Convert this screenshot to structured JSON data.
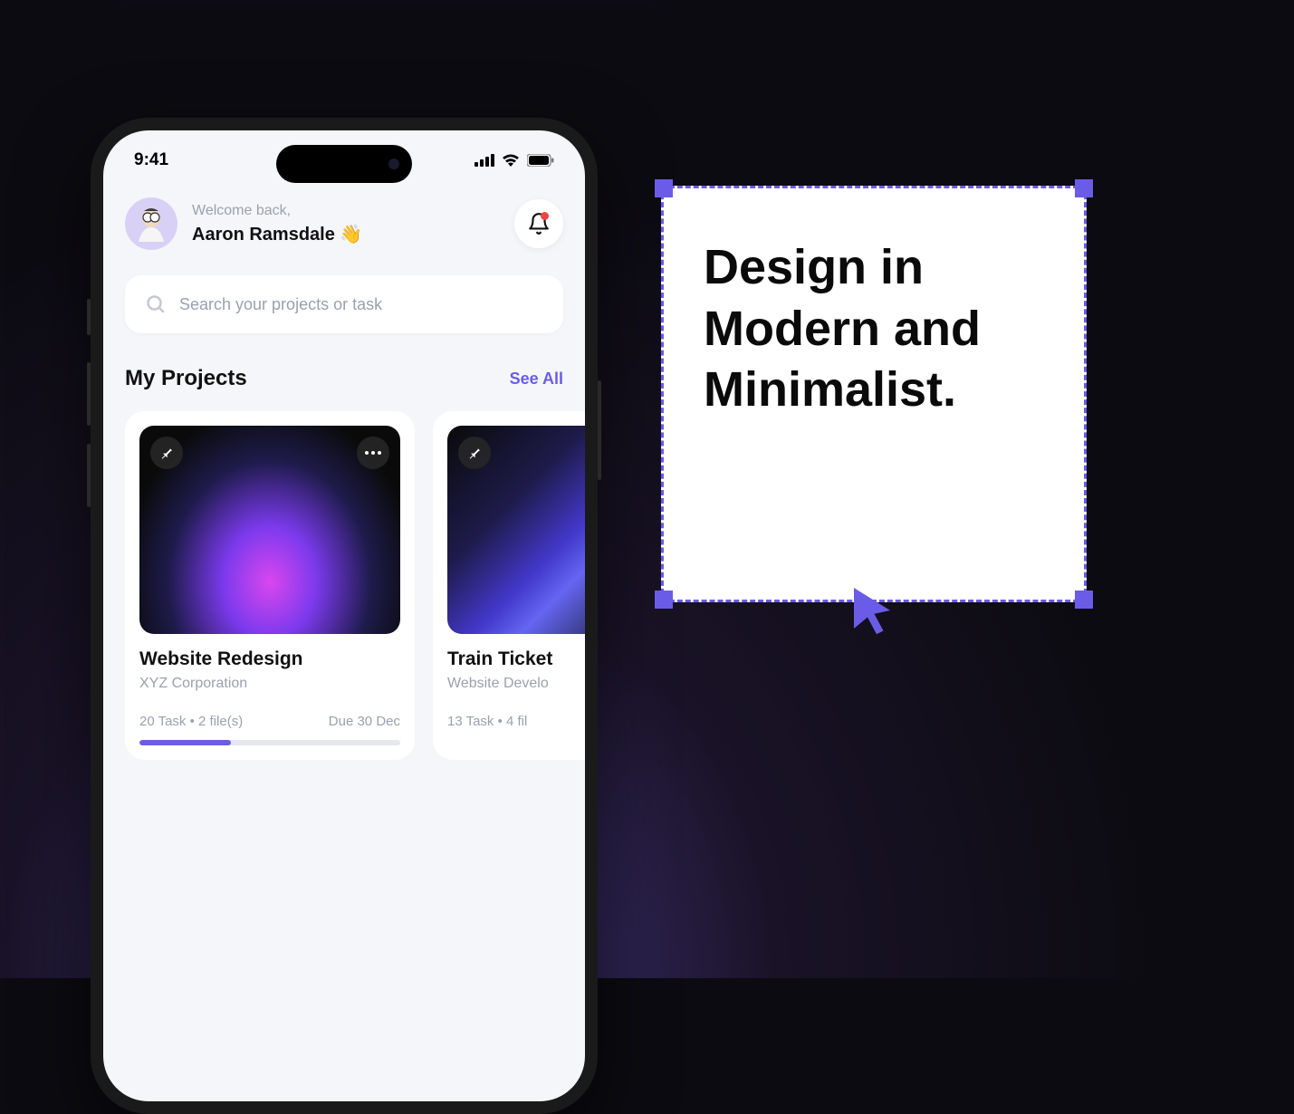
{
  "statusBar": {
    "time": "9:41"
  },
  "header": {
    "welcome": "Welcome back,",
    "name": "Aaron Ramsdale 👋"
  },
  "search": {
    "placeholder": "Search your projects or task"
  },
  "projects": {
    "title": "My Projects",
    "seeAll": "See All",
    "cards": [
      {
        "title": "Website Redesign",
        "subtitle": "XYZ Corporation",
        "metaLeft": "20 Task  •  2 file(s)",
        "metaRight": "Due 30 Dec"
      },
      {
        "title": "Train Ticket",
        "subtitle": "Website Develo",
        "metaLeft": "13 Task  •  4 fil",
        "metaRight": ""
      }
    ]
  },
  "promo": {
    "text": "Design in Modern and Minimalist."
  }
}
